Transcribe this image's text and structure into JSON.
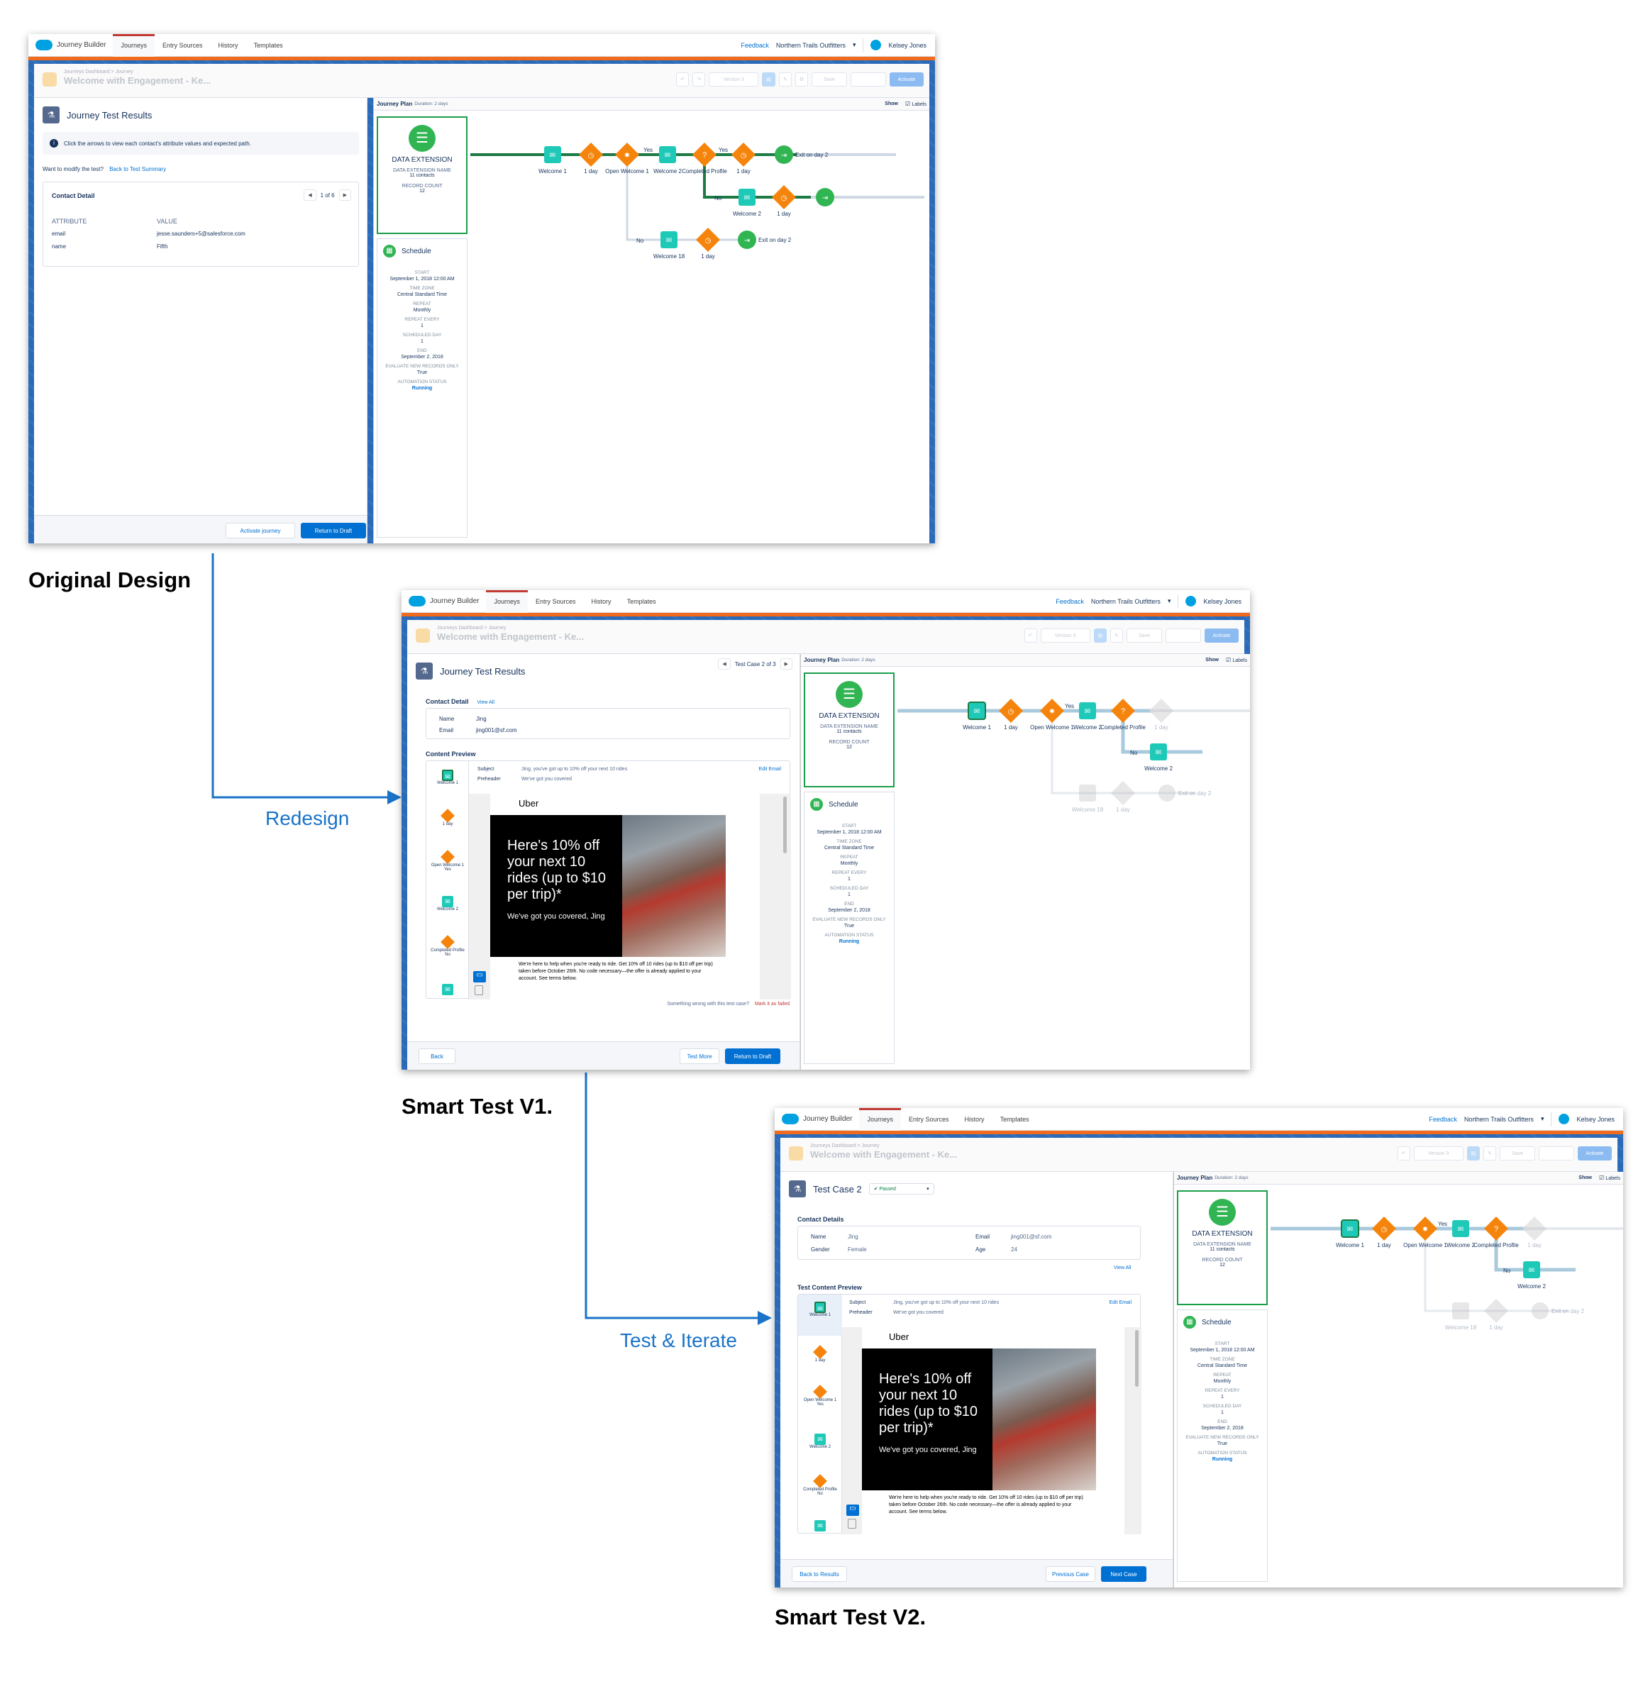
{
  "nav": {
    "brand": "Journey Builder",
    "tabs": [
      "Journeys",
      "Entry Sources",
      "History",
      "Templates"
    ],
    "feedback": "Feedback",
    "org": "Northern Trails Outfitters",
    "user": "Kelsey Jones"
  },
  "header": {
    "crumbs": "Journeys Dashboard > Journey",
    "title": "Welcome with Engagement - Ke...",
    "version": "Version 3",
    "save": "Save",
    "activate": "Activate"
  },
  "plan": {
    "title": "Journey Plan",
    "duration": "Duration: 2 days",
    "show": "Show",
    "labels": "Labels"
  },
  "entry": {
    "title": "DATA EXTENSION",
    "name_label": "DATA EXTENSION NAME",
    "name_value": "11 contacts",
    "count_label": "RECORD COUNT",
    "count_value": "12"
  },
  "schedule": {
    "title": "Schedule",
    "items": [
      {
        "k": "START",
        "v": "September 1, 2018 12:00 AM"
      },
      {
        "k": "TIME ZONE",
        "v": "Central Standard Time"
      },
      {
        "k": "REPEAT",
        "v": "Monthly"
      },
      {
        "k": "REPEAT EVERY",
        "v": "1"
      },
      {
        "k": "SCHEDULED DAY",
        "v": "1"
      },
      {
        "k": "END",
        "v": "September 2, 2018"
      },
      {
        "k": "EVALUATE NEW RECORDS ONLY",
        "v": "True"
      },
      {
        "k": "AUTOMATION STATUS",
        "v": "Running"
      }
    ]
  },
  "nodes": {
    "welcome1": "Welcome 1",
    "day": "1 day",
    "open": "Open Welcome 1",
    "welcome2": "Welcome 2",
    "completed": "Completed Profile",
    "exit": "Exit on day 2",
    "welcome18": "Welcome 18",
    "yes": "Yes",
    "no": "No"
  },
  "s1": {
    "title": "Journey Test Results",
    "info": "Click the arrows to view each contact's attribute values and expected path.",
    "modify": "Want to modify the test?",
    "back_summary": "Back to Test Summary",
    "contact_detail": "Contact Detail",
    "pager": "1 of 6",
    "attr_h": "ATTRIBUTE",
    "val_h": "VALUE",
    "rows": [
      {
        "a": "email",
        "v": "jesse.saunders+5@salesforce.com"
      },
      {
        "a": "name",
        "v": "Fifth"
      }
    ],
    "activate_journey": "Activate journey",
    "return_draft": "Return to Draft"
  },
  "s2": {
    "title": "Journey Test Results",
    "pager": "Test Case 2 of 3",
    "contact_detail": "Contact Detail",
    "view_all": "View All",
    "name_k": "Name",
    "name_v": "Jing",
    "email_k": "Email",
    "email_v": "jing001@sf.com",
    "content_preview": "Content Preview",
    "subject_k": "Subject",
    "subject_v": "Jing, you've got up to 10% off your next 10 rides",
    "preheader_k": "Preheader",
    "preheader_v": "We've got you covered",
    "edit_email": "Edit Email",
    "wrong": "Something wrong with this test case?",
    "mark_failed": "Mark it as failed",
    "back": "Back",
    "test_more": "Test More",
    "return_draft": "Return to Draft"
  },
  "s3": {
    "title": "Test Case 2",
    "status": "Passed",
    "contact_details": "Contact Details",
    "name_k": "Name",
    "name_v": "Jing",
    "gender_k": "Gender",
    "gender_v": "Female",
    "email_k": "Email",
    "email_v": "jing001@sf.com",
    "age_k": "Age",
    "age_v": "24",
    "view_all": "View All",
    "content_preview": "Test Content Preview",
    "subject_k": "Subject",
    "subject_v": "Jing, you've got up to 10% off your next 10 rides",
    "preheader_k": "Preheader",
    "preheader_v": "We've got you covered",
    "edit_email": "Edit Email",
    "back_results": "Back to Results",
    "prev_case": "Previous Case",
    "next_case": "Next Case"
  },
  "email": {
    "brand": "Uber",
    "headline": "Here's 10% off your next 10 rides (up to $10 per trip)*",
    "sub": "We've got you covered, Jing",
    "body": "We're here to help when you're ready to ride. Get 10% off 10 rides (up to $10 off per trip) taken before October 26th. No code necessary—the offer is already applied to your account. See terms below."
  },
  "timeline": {
    "welcome1": "Welcome 1",
    "day": "1 day",
    "open": "Open Welcome 1",
    "yes": "Yes",
    "welcome2": "Welcome 2",
    "completed": "Completed Profile",
    "no": "No"
  },
  "captions": {
    "original": "Original Design",
    "redesign": "Redesign",
    "v1": "Smart Test V1.",
    "iterate": "Test & Iterate",
    "v2": "Smart Test V2."
  }
}
